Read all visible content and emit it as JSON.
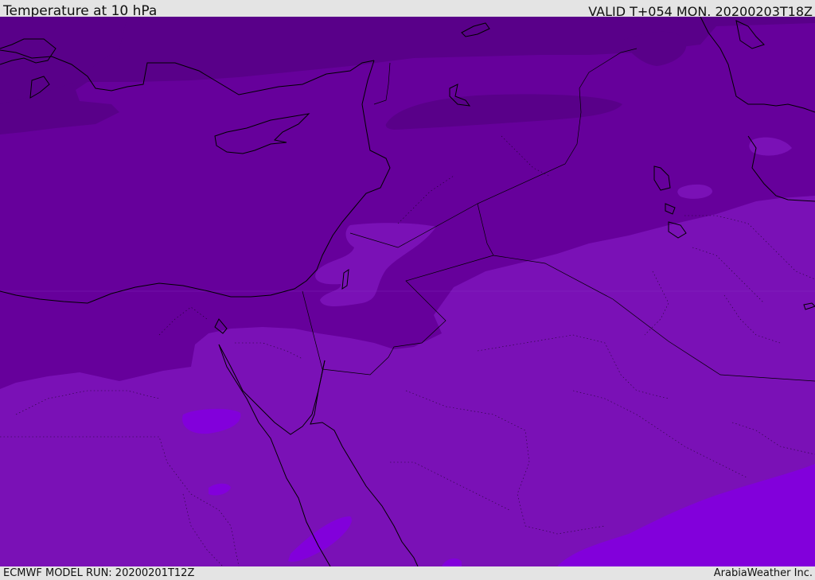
{
  "header": {
    "title": "Temperature at 10 hPa",
    "valid": "VALID T+054 MON. 20200203T18Z"
  },
  "footer": {
    "model_run": "ECMWF MODEL RUN: 20200201T12Z",
    "credit": "ArabiaWeather Inc."
  },
  "colors": {
    "background": "#e4e4e4",
    "band_warm": "#7a11b6",
    "band_mid": "#66009b",
    "band_cold": "#590089",
    "band_hot": "#8200db",
    "coastline": "#000000"
  }
}
